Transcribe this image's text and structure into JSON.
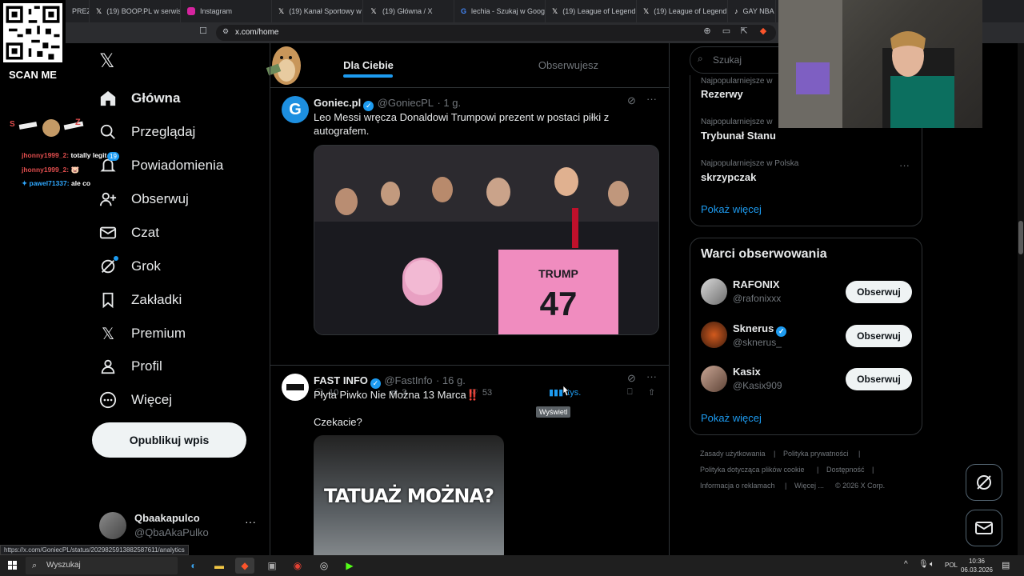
{
  "browser": {
    "tabs": [
      {
        "label": "PREZY",
        "icon": "pinned-tab"
      },
      {
        "label": "(19) BOOP.PL w serwis",
        "icon": "x-icon"
      },
      {
        "label": "Instagram",
        "icon": "instagram-icon"
      },
      {
        "label": "(19) Kanał Sportowy w",
        "icon": "x-icon"
      },
      {
        "label": "(19) Główna / X",
        "icon": "x-icon"
      },
      {
        "label": "lechia - Szukaj w Goog",
        "icon": "google-icon"
      },
      {
        "label": "(19) League of Legend",
        "icon": "x-icon"
      },
      {
        "label": "(19) League of Legend",
        "icon": "x-icon"
      },
      {
        "label": "GAY NBA",
        "icon": "tiktok-icon"
      }
    ],
    "url": "x.com/home",
    "status_url": "https://x.com/GoniecPL/status/2029825913882587611/analytics"
  },
  "overlay": {
    "qr_label": "SCAN ME",
    "chat": [
      {
        "user": "jhonny1999_2:",
        "message": "totally legit",
        "user_color": "#e04d4d"
      },
      {
        "user": "jhonny1999_2:",
        "message": "🐷",
        "user_color": "#e04d4d"
      },
      {
        "user": "pawel71337:",
        "message": "ale co",
        "user_color": "#2fa8ff"
      }
    ]
  },
  "nav": {
    "items": [
      {
        "label": "Główna",
        "icon": "home-icon",
        "active": true
      },
      {
        "label": "Przeglądaj",
        "icon": "search-icon"
      },
      {
        "label": "Powiadomienia",
        "icon": "bell-icon",
        "badge": "19"
      },
      {
        "label": "Obserwuj",
        "icon": "add-person-icon"
      },
      {
        "label": "Czat",
        "icon": "mail-icon"
      },
      {
        "label": "Grok",
        "icon": "grok-icon"
      },
      {
        "label": "Zakładki",
        "icon": "bookmark-icon"
      },
      {
        "label": "Premium",
        "icon": "x-icon"
      },
      {
        "label": "Profil",
        "icon": "person-icon"
      },
      {
        "label": "Więcej",
        "icon": "more-icon"
      }
    ],
    "post_button": "Opublikuj wpis",
    "account": {
      "name": "Qbaakapulco",
      "handle": "@QbaAkaPulko"
    }
  },
  "feed": {
    "tabs": [
      "Dla Ciebie",
      "Obserwujesz"
    ],
    "tweets": [
      {
        "name": "Goniec.pl",
        "handle": "@GoniecPL",
        "time": "· 1 g.",
        "text": "Leo Messi wręcza Donaldowi Trumpowi prezent w postaci piłki z autografem.",
        "image_text": "TRUMP 47",
        "replies": "10",
        "retweets": "3",
        "likes": "53",
        "views": "tys.",
        "tooltip": "Wyświetl"
      },
      {
        "name": "FAST INFO",
        "handle": "@FastInfo",
        "time": "· 16 g.",
        "text": "Płyta Piwko Nie Można 13 Marca‼️",
        "text2": "Czekacie?",
        "image_text": "TATUAŻ MOŻNA?"
      }
    ]
  },
  "right": {
    "search_placeholder": "Szukaj",
    "trends": [
      {
        "category": "Najpopularniejsze w",
        "name": "Rezerwy"
      },
      {
        "category": "Najpopularniejsze w",
        "name": "Trybunał Stanu"
      },
      {
        "category": "Najpopularniejsze w Polska",
        "name": "skrzypczak"
      }
    ],
    "show_more": "Pokaż więcej",
    "who_title": "Warci obserwowania",
    "who": [
      {
        "name": "RAFONIX",
        "handle": "@rafonixxx",
        "verified": false
      },
      {
        "name": "Sknerus",
        "handle": "@sknerus_",
        "verified": true
      },
      {
        "name": "Kasix",
        "handle": "@Kasix909",
        "verified": false
      }
    ],
    "follow_label": "Obserwuj",
    "footer": [
      "Zasady użytkowania",
      "|",
      "Polityka prywatności",
      "|",
      "Polityka dotycząca plików cookie",
      "|",
      "Dostępność",
      "|",
      "Informacja o reklamach",
      "|",
      "Więcej ...",
      "© 2026 X Corp."
    ]
  },
  "taskbar": {
    "search": "Wyszukaj",
    "lang": "POL",
    "time": "10:36",
    "date": "06.03.2026"
  },
  "colors": {
    "accent": "#1d9bf0",
    "background": "#000000",
    "border": "#2f3336"
  }
}
